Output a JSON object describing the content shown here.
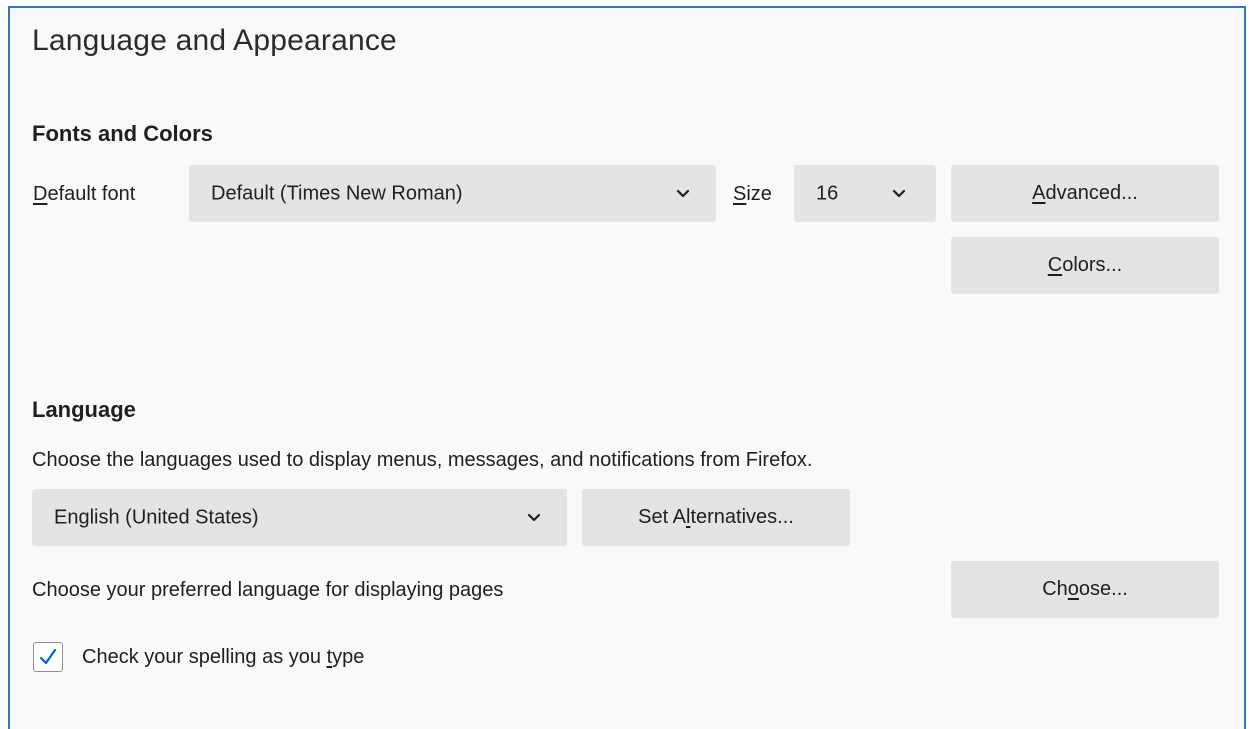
{
  "pane": {
    "title": "Language and Appearance"
  },
  "fonts_colors": {
    "heading": "Fonts and Colors",
    "default_font_label_access": "D",
    "default_font_label_rest": "efault font",
    "default_font_value": "Default (Times New Roman)",
    "size_label_access": "S",
    "size_label_rest": "ize",
    "size_value": "16",
    "advanced_button_access": "A",
    "advanced_button_rest": "dvanced...",
    "colors_button_access": "C",
    "colors_button_rest": "olors..."
  },
  "language": {
    "heading": "Language",
    "description": "Choose the languages used to display menus, messages, and notifications from Firefox.",
    "ui_language_value": "English (United States)",
    "set_alternatives_pre": "Set A",
    "set_alternatives_access": "l",
    "set_alternatives_post": "ternatives...",
    "preferred_language_label": "Choose your preferred language for displaying pages",
    "choose_button_pre": "Ch",
    "choose_button_access": "o",
    "choose_button_post": "ose...",
    "spellcheck_pre": "Check your spelling as you ",
    "spellcheck_access": "t",
    "spellcheck_post": "ype",
    "spellcheck_checked": true
  },
  "colors": {
    "frame_border": "#2f7bbf",
    "control_bg": "#e4e4e6",
    "check_mark": "#0060df"
  },
  "icons": {
    "dropdown": "chevron-down-icon",
    "check": "checkmark-icon"
  }
}
